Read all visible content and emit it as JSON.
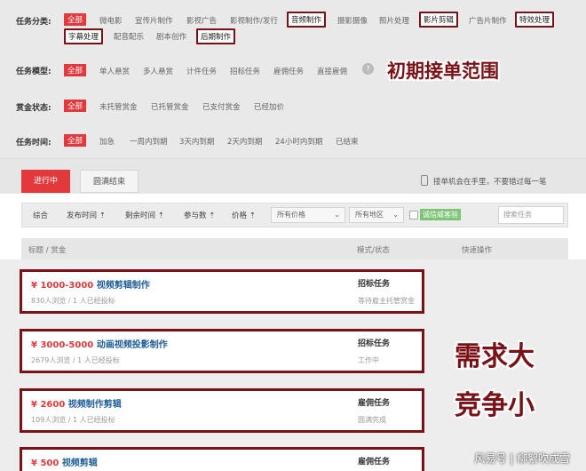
{
  "filters": {
    "type": {
      "label": "任务分类:",
      "options": [
        "全部",
        "微电影",
        "宣传片制作",
        "影视广告",
        "影视制作/发行",
        "音频制作",
        "摄影摄像",
        "照片处理",
        "影片剪辑",
        "广告片制作",
        "特效处理",
        "字幕处理",
        "配音配乐",
        "剧本创作",
        "后期制作"
      ]
    },
    "model": {
      "label": "任务模型:",
      "options": [
        "全部",
        "单人悬赏",
        "多人悬赏",
        "计件任务",
        "招标任务",
        "雇佣任务",
        "直接雇佣"
      ]
    },
    "reward": {
      "label": "赏金状态:",
      "options": [
        "全部",
        "未托管赏金",
        "已托管赏金",
        "已支付赏金",
        "已经加价"
      ]
    },
    "time": {
      "label": "任务时间:",
      "options": [
        "全部",
        "加急",
        "一周内到期",
        "3天内到期",
        "2天内到期",
        "24小时内到期",
        "已结束"
      ]
    }
  },
  "annotations": {
    "range": "初期接单范围",
    "demand": "需求大",
    "competition": "竞争小"
  },
  "tabs": {
    "active": "进行中",
    "done": "圆满结束"
  },
  "phone_note": "接单机会在手里，不要错过每一笔",
  "sort": {
    "items": [
      "综合",
      "发布时间 ⇡",
      "剩余时间 ⇡",
      "参与数 ⇡",
      "价格 ⇡"
    ],
    "price_select": "所有价格",
    "region_select": "所有地区",
    "trust_badge": "诚信威客验",
    "search_placeholder": "搜索任务"
  },
  "columns": {
    "title": "标题 / 赏金",
    "mode": "模式/状态",
    "action": "快速操作"
  },
  "tasks": [
    {
      "price": "¥ 1000-3000",
      "title": "视频剪辑制作",
      "meta": "830人浏览 / 1 人已经投标",
      "mode": "招标任务",
      "status": "等待雇主托管赏金"
    },
    {
      "price": "¥ 3000-5000",
      "title": "动画视频投影制作",
      "meta": "2679人浏览 / 1 人已经投标",
      "mode": "招标任务",
      "status": "工作中"
    },
    {
      "price": "¥ 2600",
      "title": "视频制作剪辑",
      "meta": "109人浏览 / 1 人已经投标",
      "mode": "雇佣任务",
      "status": "圆满完成"
    },
    {
      "price": "¥ 500",
      "title": "视频剪辑",
      "meta": "",
      "mode": "雇佣任务",
      "status": ""
    }
  ],
  "watermark": "风易号 | 柳絮吹成雪",
  "help_glyph": "?"
}
